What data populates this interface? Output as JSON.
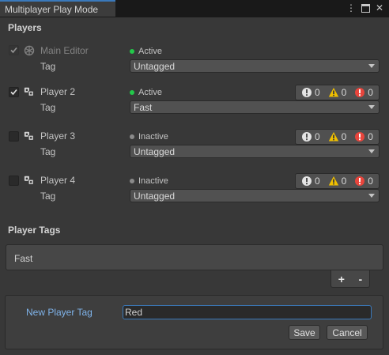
{
  "window": {
    "tab_title": "Multiplayer Play Mode",
    "controls": {
      "menu_icon": "kebab-menu-icon",
      "maximize_icon": "maximize-icon",
      "close_icon": "close-icon"
    }
  },
  "players_section": {
    "title": "Players",
    "tag_label": "Tag",
    "players": [
      {
        "name": "Main Editor",
        "checked": true,
        "disabled": true,
        "status": "Active",
        "status_color": "#23c84a",
        "tag": "Untagged",
        "show_counts": false
      },
      {
        "name": "Player 2",
        "checked": true,
        "disabled": false,
        "status": "Active",
        "status_color": "#23c84a",
        "tag": "Fast",
        "show_counts": true,
        "counts": {
          "info": "0",
          "warning": "0",
          "error": "0"
        }
      },
      {
        "name": "Player 3",
        "checked": false,
        "disabled": false,
        "status": "Inactive",
        "status_color": "#8a8a8a",
        "tag": "Untagged",
        "show_counts": true,
        "counts": {
          "info": "0",
          "warning": "0",
          "error": "0"
        }
      },
      {
        "name": "Player 4",
        "checked": false,
        "disabled": false,
        "status": "Inactive",
        "status_color": "#8a8a8a",
        "tag": "Untagged",
        "show_counts": true,
        "counts": {
          "info": "0",
          "warning": "0",
          "error": "0"
        }
      }
    ]
  },
  "player_tags": {
    "title": "Player Tags",
    "items": [
      "Fast"
    ],
    "add_label": "+",
    "remove_label": "-"
  },
  "new_tag": {
    "label": "New Player Tag",
    "value": "Red",
    "save_label": "Save",
    "cancel_label": "Cancel"
  },
  "colors": {
    "accent": "#3a79bb",
    "link": "#7fb3ea",
    "warning": "#f0c000",
    "error": "#e8453c",
    "active": "#23c84a"
  }
}
